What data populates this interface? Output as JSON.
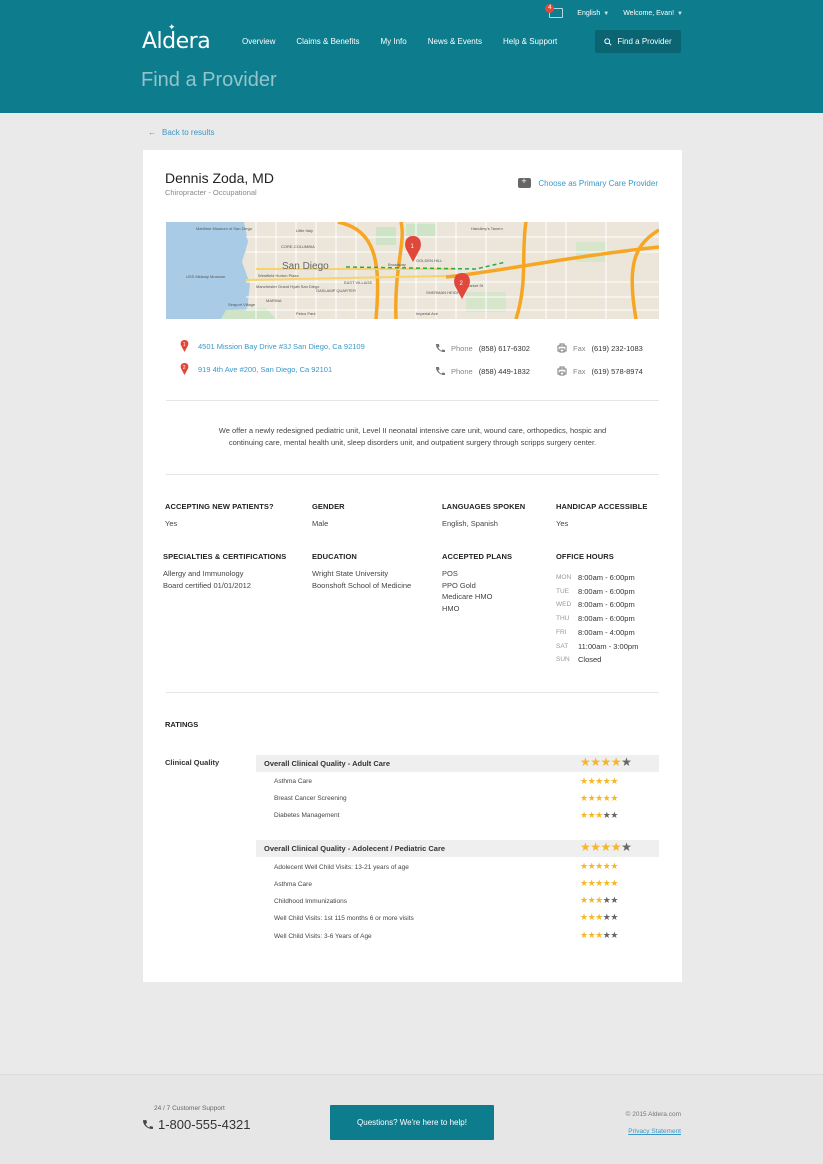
{
  "header": {
    "logo": "Aldera",
    "language": "English",
    "welcome": "Welcome, Evan!",
    "notifications_count": "4",
    "nav": [
      "Overview",
      "Claims & Benefits",
      "My Info",
      "News & Events",
      "Help & Support"
    ],
    "find_provider_btn": "Find a Provider",
    "page_title": "Find a Provider"
  },
  "back_link": "Back to results",
  "provider": {
    "name": "Dennis Zoda, MD",
    "specialty": "Chiropracter - Occupational",
    "pcp_link": "Choose as Primary Care Provider"
  },
  "map": {
    "labels": [
      "San Diego",
      "Maritime Museum of San Diego",
      "USS Midway Museum",
      "Seaport Village",
      "Petco Park",
      "Westfield Horton Plaza",
      "Manchester Grand Hyatt San Diego",
      "Little Italy",
      "CORE-COLUMBIA",
      "MARINA",
      "GASLAMP QUARTER",
      "EAST VILLAGE",
      "GOLDEN HILL",
      "SHERMAN HEIGHTS",
      "Broadway",
      "Market St",
      "Imperial Ave",
      "Handlery's Tavern"
    ],
    "markers": [
      "1",
      "2"
    ]
  },
  "locations": [
    {
      "num": "1",
      "address": "4501 Mission Bay Drive #3J San Diego, Ca 92109",
      "phone_label": "Phone",
      "phone": "(858) 617-6302",
      "fax_label": "Fax",
      "fax": "(619) 232-1083"
    },
    {
      "num": "2",
      "address": "919 4th Ave #200, San Diego, Ca 92101",
      "phone_label": "Phone",
      "phone": "(858) 449-1832",
      "fax_label": "Fax",
      "fax": "(619) 578-8974"
    }
  ],
  "description_1": "We offer a newly redesigned pediatric unit, Level II neonatal intensive care unit, wound care, orthopedics, hospic and",
  "description_2": "continuing care, mental health unit, sleep disorders unit, and outpatient surgery through scripps surgery center.",
  "info": {
    "accepting_h": "ACCEPTING NEW PATIENTS?",
    "accepting_v": "Yes",
    "gender_h": "GENDER",
    "gender_v": "Male",
    "languages_h": "LANGUAGES SPOKEN",
    "languages_v": "English, Spanish",
    "handicap_h": "HANDICAP ACCESSIBLE",
    "handicap_v": "Yes",
    "specialties_h": "SPECIALTIES & CERTIFICATIONS",
    "specialties_v1": "Allergy and Immunology",
    "specialties_v2": "Board certified 01/01/2012",
    "education_h": "EDUCATION",
    "education_v1": "Wright State University",
    "education_v2": "Boonshoft School of Medicine",
    "plans_h": "ACCEPTED PLANS",
    "plans": [
      "POS",
      "PPO Gold",
      "Medicare HMO",
      "HMO"
    ],
    "hours_h": "OFFICE HOURS",
    "hours": [
      {
        "day": "MON",
        "time": "8:00am - 6:00pm"
      },
      {
        "day": "TUE",
        "time": "8:00am - 6:00pm"
      },
      {
        "day": "WED",
        "time": "8:00am - 6:00pm"
      },
      {
        "day": "THU",
        "time": "8:00am - 6:00pm"
      },
      {
        "day": "FRI",
        "time": "8:00am - 4:00pm"
      },
      {
        "day": "SAT",
        "time": "11:00am - 3:00pm"
      },
      {
        "day": "SUN",
        "time": "Closed"
      }
    ]
  },
  "ratings": {
    "heading": "RATINGS",
    "category": "Clinical Quality",
    "groups": [
      {
        "title": "Overall Clinical Quality - Adult Care",
        "stars": 4,
        "items": [
          {
            "label": "Asthma Care",
            "stars": 5
          },
          {
            "label": "Breast Cancer Screening",
            "stars": 5
          },
          {
            "label": "Diabetes Management",
            "stars": 3
          }
        ]
      },
      {
        "title": "Overall Clinical Quality - Adolecent / Pediatric Care",
        "stars": 4,
        "items": [
          {
            "label": "Adolecent Well Child Visits: 13-21 years of age",
            "stars": 5
          },
          {
            "label": "Asthma Care",
            "stars": 5
          },
          {
            "label": "Childhood Immunizations",
            "stars": 3
          },
          {
            "label": "Well Child Visits: 1st 115 months 6 or more visits",
            "stars": 3
          },
          {
            "label": "Well Child Visits: 3-6 Years of Age",
            "stars": 3
          }
        ]
      }
    ]
  },
  "footer": {
    "support_label": "24 / 7 Customer Support",
    "phone": "1-800-555-4321",
    "help_btn": "Questions? We're here to help!",
    "copyright": "© 2015 Aldera.com",
    "privacy": "Privacy Statement"
  },
  "colors": {
    "header": "#0d7c8c",
    "link": "#3a98c9",
    "star": "#f5b62a",
    "pin": "#e0483b"
  }
}
